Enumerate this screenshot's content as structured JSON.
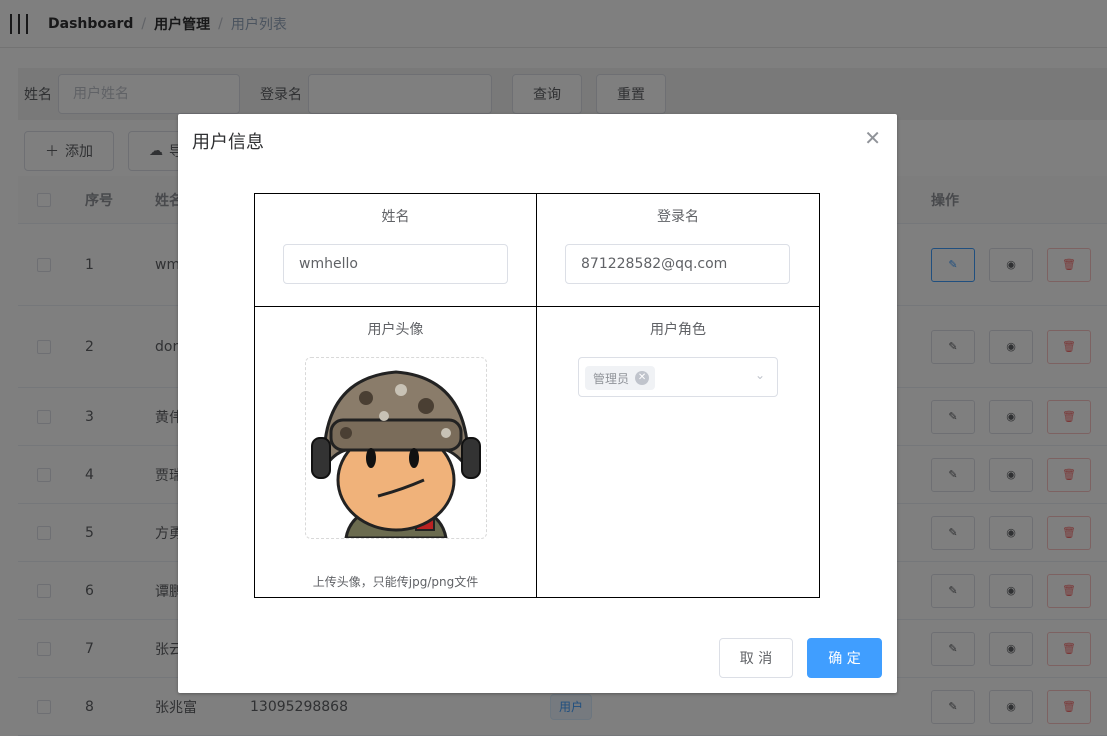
{
  "breadcrumb": [
    "Dashboard",
    "用户管理",
    "用户列表"
  ],
  "search": {
    "name_label": "姓名",
    "name_placeholder": "用户姓名",
    "login_label": "登录名",
    "login_placeholder": "",
    "query_label": "查询",
    "reset_label": "重置"
  },
  "toolbar": {
    "add_label": "添加",
    "export_label": "导"
  },
  "table": {
    "headers": {
      "index": "序号",
      "name": "姓名",
      "ops": "操作"
    },
    "rows": [
      {
        "index": "1",
        "name": "wm",
        "login": "",
        "role": ""
      },
      {
        "index": "2",
        "name": "don",
        "login": "",
        "role": ""
      },
      {
        "index": "3",
        "name": "黄伟",
        "login": "",
        "role": ""
      },
      {
        "index": "4",
        "name": "贾瑞",
        "login": "",
        "role": ""
      },
      {
        "index": "5",
        "name": "方勇",
        "login": "",
        "role": ""
      },
      {
        "index": "6",
        "name": "谭鹏",
        "login": "",
        "role": ""
      },
      {
        "index": "7",
        "name": "张云",
        "login": "",
        "role": ""
      },
      {
        "index": "8",
        "name": "张兆富",
        "login": "13095298868",
        "role": "用户"
      }
    ]
  },
  "dialog": {
    "title": "用户信息",
    "name_label": "姓名",
    "name_value": "wmhello",
    "login_label": "登录名",
    "login_value": "871228582@qq.com",
    "avatar_label": "用户头像",
    "upload_tip": "上传头像，只能传jpg/png文件",
    "role_label": "用户角色",
    "role_tag": "管理员",
    "cancel_label": "取 消",
    "ok_label": "确 定"
  },
  "colors": {
    "primary": "#409eff",
    "danger": "#f56c6c"
  },
  "icons": [
    "hamburger-icon",
    "plus-icon",
    "cloud-upload-icon",
    "edit-icon",
    "view-icon",
    "delete-icon",
    "close-icon",
    "chevron-down-icon",
    "avatar-illustration"
  ]
}
